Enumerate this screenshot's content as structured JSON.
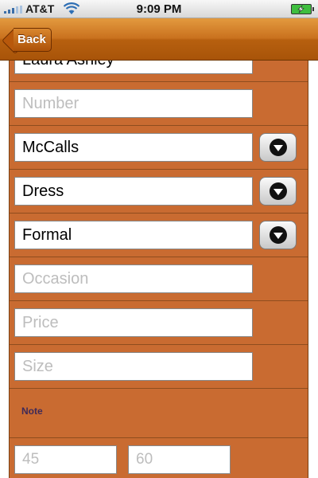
{
  "status_bar": {
    "carrier": "AT&T",
    "time": "9:09 PM",
    "icons": [
      "signal-icon",
      "wifi-icon",
      "battery-charging-icon"
    ]
  },
  "nav": {
    "back_label": "Back"
  },
  "form": {
    "brand_value": "Laura Ashley",
    "number_placeholder": "Number",
    "company_value": "McCalls",
    "type_value": "Dress",
    "style_value": "Formal",
    "occasion_placeholder": "Occasion",
    "price_placeholder": "Price",
    "size_placeholder": "Size",
    "note_label": "Note",
    "size_from_placeholder": "45",
    "size_to_placeholder": "60"
  },
  "colors": {
    "panel_bg": "#c96b31",
    "nav_bg": "#c9711e",
    "note_text": "#3e2a58"
  }
}
